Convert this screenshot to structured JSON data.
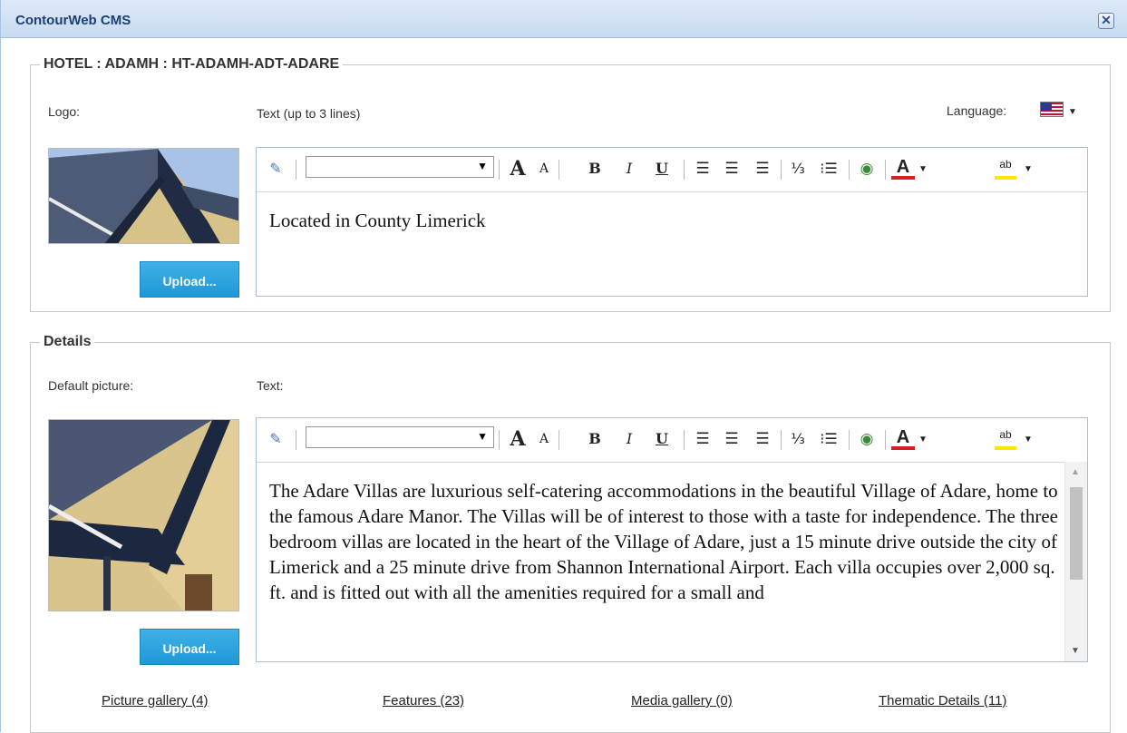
{
  "window": {
    "title": "ContourWeb CMS",
    "close_label": "✕"
  },
  "hotel_section": {
    "legend": "HOTEL : ADAMH : HT-ADAMH-ADT-ADARE",
    "logo_label": "Logo:",
    "text_label": "Text (up to 3 lines)",
    "language_label": "Language:",
    "language_flag": "us-flag-icon",
    "upload_label": "Upload...",
    "editor_text": "Located in County Limerick"
  },
  "details_section": {
    "legend": "Details",
    "picture_label": "Default picture:",
    "text_label": "Text:",
    "upload_label": "Upload...",
    "editor_text": "The Adare Villas are luxurious self-catering accommodations in the beautiful Village of Adare, home to the famous Adare Manor. The Villas will be of interest to those with a taste for independence. The three bedroom villas are located in the heart of the Village of Adare, just a 15 minute drive outside the city of Limerick and a 25 minute drive from Shannon International Airport. Each villa occupies over 2,000 sq. ft. and is fitted out with all the amenities required for a small and"
  },
  "toolbar": {
    "grow_font": "A",
    "shrink_font": "A",
    "bold": "B",
    "italic": "I",
    "underline": "U",
    "font_color_letter": "A",
    "highlight_letters": "ab"
  },
  "footer_links": [
    {
      "label": "Picture gallery (4)"
    },
    {
      "label": "Features (23)"
    },
    {
      "label": "Media gallery (0)"
    },
    {
      "label": "Thematic Details (11)"
    }
  ],
  "colors": {
    "title_text": "#1c3f78",
    "upload_button": "#1f98d6",
    "font_color_bar": "#d42020",
    "highlight_bar": "#ffe600"
  }
}
